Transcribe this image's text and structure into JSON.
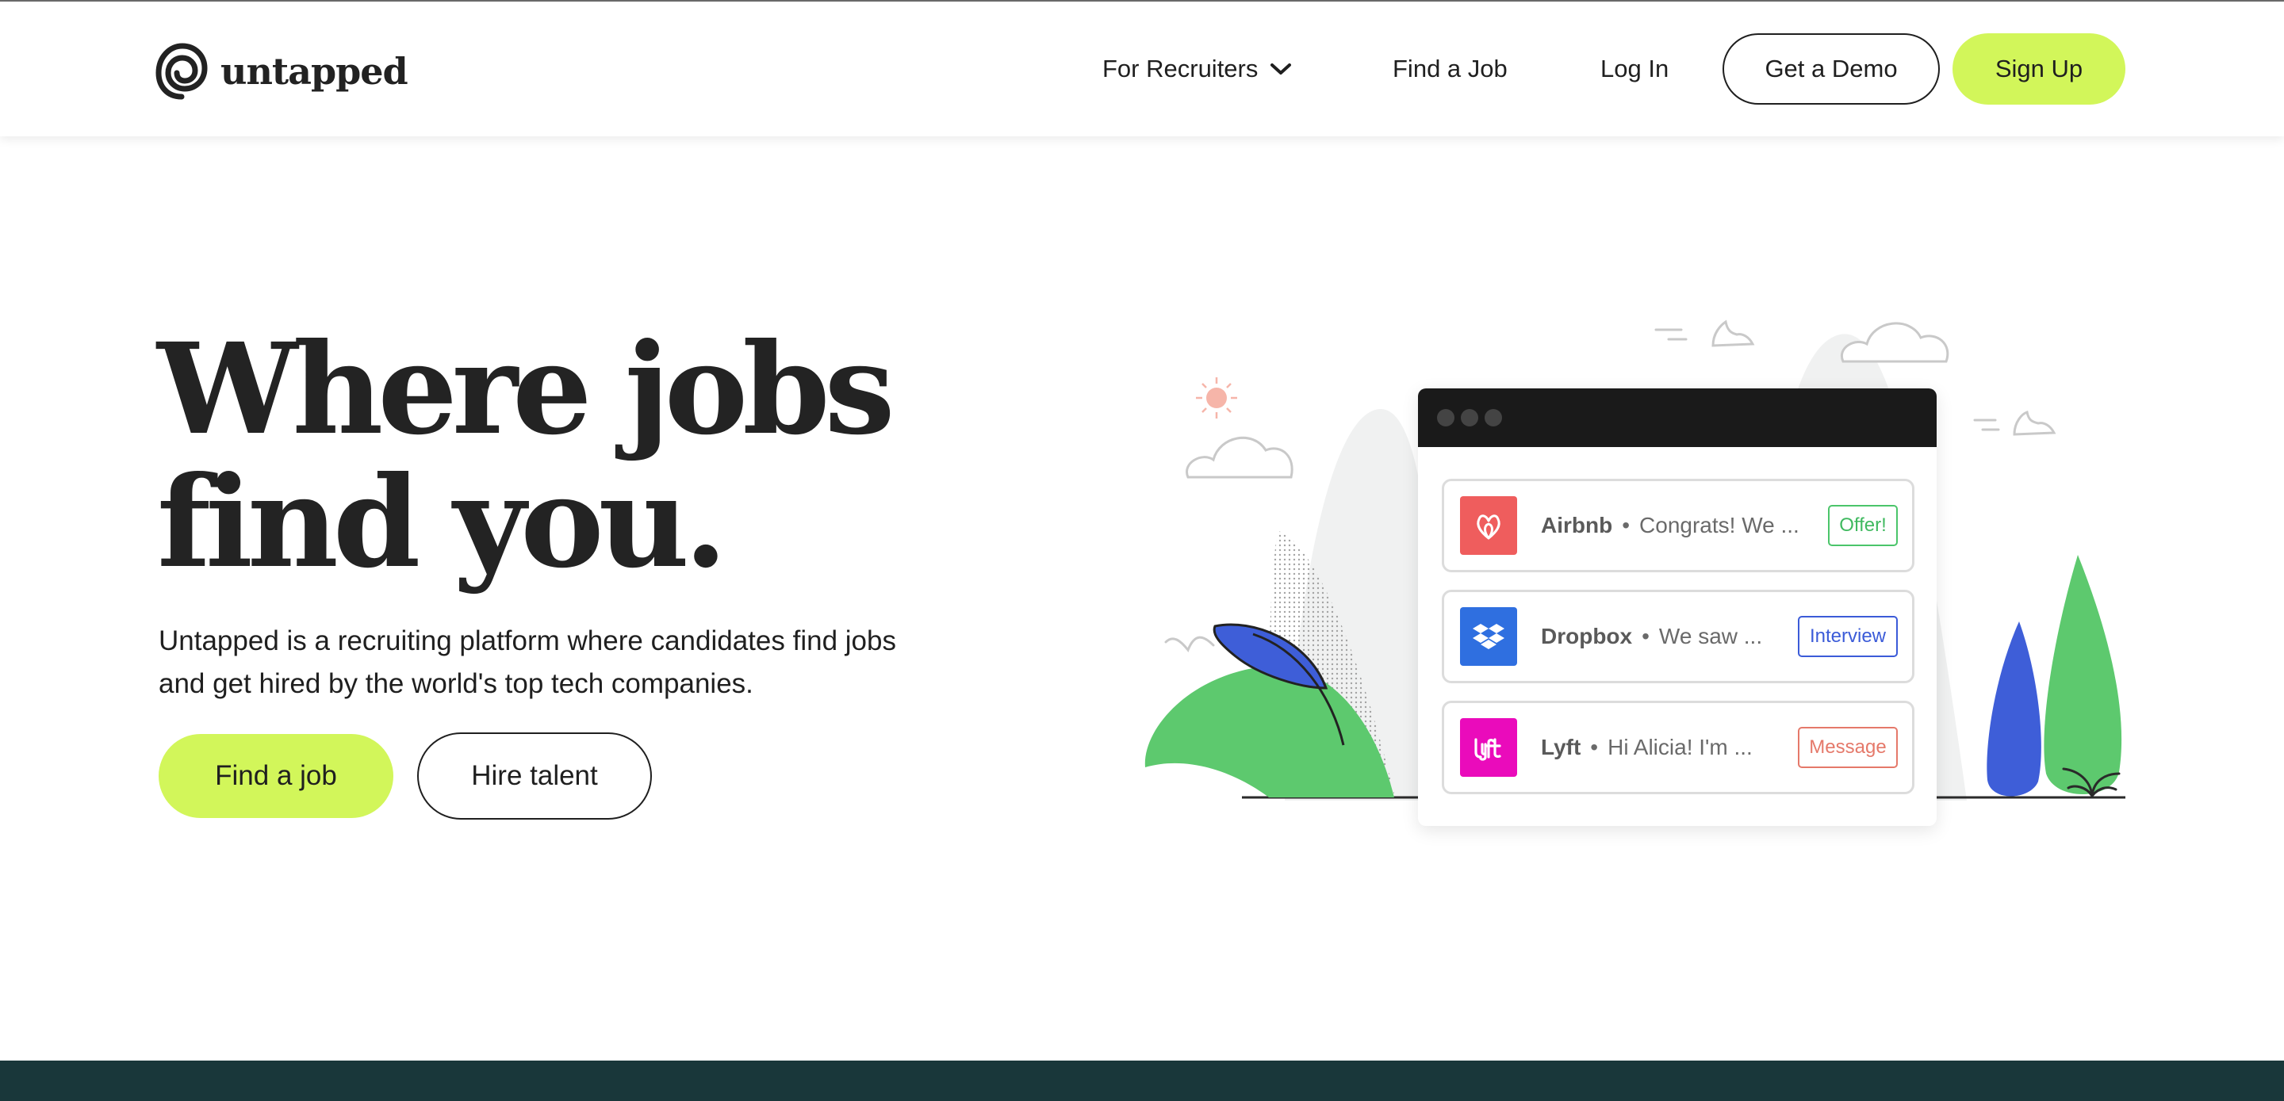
{
  "brand": {
    "name": "untapped",
    "accent": "#d2f65a",
    "footer_band": "#19373a"
  },
  "nav": {
    "recruiters_label": "For Recruiters",
    "find_job_label": "Find a Job",
    "login_label": "Log In",
    "demo_label": "Get a Demo",
    "signup_label": "Sign Up"
  },
  "hero": {
    "title_line1": "Where jobs",
    "title_line2": "find you.",
    "subtitle_line1": "Untapped is a recruiting platform where candidates find jobs",
    "subtitle_line2": "and get hired by the world's top tech companies.",
    "cta_find": "Find a job",
    "cta_hire": "Hire talent"
  },
  "messages": [
    {
      "company": "Airbnb",
      "preview": "Congrats! We ...",
      "badge": "Offer!",
      "logo_color": "#ef5d5d",
      "icon": "airbnb-logo-icon"
    },
    {
      "company": "Dropbox",
      "preview": "We saw ...",
      "badge": "Interview",
      "logo_color": "#2f6fe0",
      "icon": "dropbox-logo-icon"
    },
    {
      "company": "Lyft",
      "preview": "Hi Alicia! I'm ...",
      "badge": "Message",
      "logo_color": "#ea0bbb",
      "icon": "lyft-logo-icon"
    }
  ],
  "separator": "•"
}
